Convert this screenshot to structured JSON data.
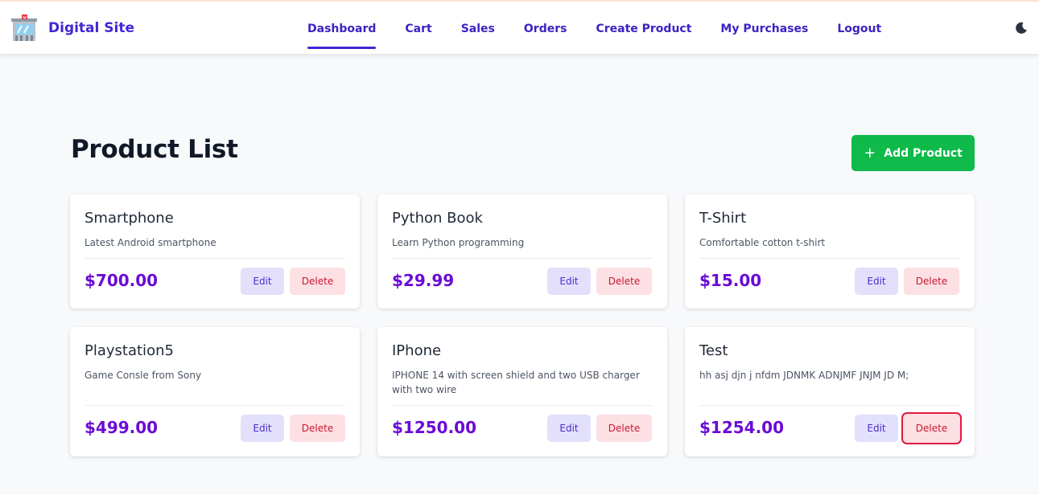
{
  "brand": {
    "name": "Digital Site",
    "icon": "store-icon",
    "accent_color": "#4325d6"
  },
  "nav": {
    "items": [
      {
        "label": "Dashboard",
        "active": true
      },
      {
        "label": "Cart",
        "active": false
      },
      {
        "label": "Sales",
        "active": false
      },
      {
        "label": "Orders",
        "active": false
      },
      {
        "label": "Create Product",
        "active": false
      },
      {
        "label": "My Purchases",
        "active": false
      },
      {
        "label": "Logout",
        "active": false
      }
    ],
    "theme_toggle_icon": "moon-icon"
  },
  "page": {
    "title": "Product List",
    "add_button_label": "Add Product",
    "add_button_icon": "plus-icon",
    "add_button_color": "#0fb94a"
  },
  "products": [
    {
      "name": "Smartphone",
      "description": "Latest Android smartphone",
      "price": "$700.00",
      "edit_label": "Edit",
      "delete_label": "Delete"
    },
    {
      "name": "Python Book",
      "description": "Learn Python programming",
      "price": "$29.99",
      "edit_label": "Edit",
      "delete_label": "Delete"
    },
    {
      "name": "T-Shirt",
      "description": "Comfortable cotton t-shirt",
      "price": "$15.00",
      "edit_label": "Edit",
      "delete_label": "Delete"
    },
    {
      "name": "Playstation5",
      "description": "Game Consle from Sony",
      "price": "$499.00",
      "edit_label": "Edit",
      "delete_label": "Delete"
    },
    {
      "name": "IPhone",
      "description": "IPHONE 14 with screen shield and two USB charger with two wire",
      "price": "$1250.00",
      "edit_label": "Edit",
      "delete_label": "Delete"
    },
    {
      "name": "Test",
      "description": "hh asj djn j nfdm JDNMK ADNJMF JNJM JD M;",
      "price": "$1254.00",
      "edit_label": "Edit",
      "delete_label": "Delete"
    }
  ],
  "colors": {
    "price": "#6b0bd6",
    "edit_bg": "#e3e0fb",
    "delete_bg": "#fde0e3",
    "delete_focus_border": "#e31a3c"
  }
}
